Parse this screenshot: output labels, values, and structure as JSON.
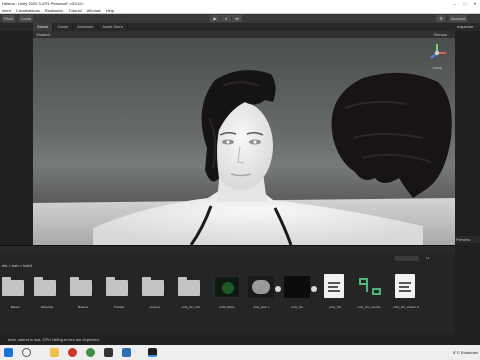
{
  "window": {
    "title": "Helena - Unity 2020.3.47f1 Personal* <DX12>",
    "controls": [
      "–",
      "□",
      "✕"
    ]
  },
  "menu": [
    "ment",
    "Createatshas",
    "Reallusion",
    "Tutorial",
    "Window",
    "Help"
  ],
  "toolbar": {
    "pivot_label": "Pivot",
    "local_label": "Local",
    "play_icons": [
      "▶",
      "⏸",
      "⏭"
    ],
    "account_label": "Account"
  },
  "scene_tabs": [
    "Scene",
    "Game",
    "Animator",
    "Asset Store"
  ],
  "scene_toolbar": {
    "shading": "Shaded",
    "gizmos": "Gizmos"
  },
  "gizmo": {
    "persp_label": "< Persp"
  },
  "inspector": {
    "header": "Inspector",
    "preview_label": "Preview"
  },
  "project": {
    "breadcrumb": "ets > bab > bab3",
    "assets": [
      {
        "label": "Baked",
        "kind": "folder"
      },
      {
        "label": "Materials",
        "kind": "folder"
      },
      {
        "label": "Meshes",
        "kind": "folder"
      },
      {
        "label": "Prefabs",
        "kind": "folder"
      },
      {
        "label": "textures",
        "kind": "folder"
      },
      {
        "label": "unity_fbx_hair",
        "kind": "folder"
      },
      {
        "label": "bab3 (Mate",
        "kind": "material"
      },
      {
        "label": "unity_Hair 1",
        "kind": "mesh"
      },
      {
        "label": "unity_fbx",
        "kind": "dark"
      },
      {
        "label": "unity_fbx",
        "kind": "doc"
      },
      {
        "label": "unity_fbx_animat...",
        "kind": "anim"
      },
      {
        "label": "unity_fbx_shader S",
        "kind": "doc"
      }
    ],
    "count": "12"
  },
  "status": {
    "message": "beer, skeret is lost. GPU hitting errors are expected."
  },
  "taskbar": {
    "weather": "5°C Eclaircies",
    "icons": [
      "start-icon",
      "search-icon",
      "file-explorer-icon",
      "opera-icon",
      "chrome-icon",
      "unity-icon",
      "store-icon"
    ]
  },
  "colors": {
    "viewport_top": "#4a4e4c",
    "viewport_horizon": "#767a78",
    "floor": "#bdbdbf",
    "skin": "#eeeeee",
    "hair": "#161313",
    "panel": "#252525",
    "toolbar": "#383838",
    "taskbar": "#eeeeee"
  }
}
